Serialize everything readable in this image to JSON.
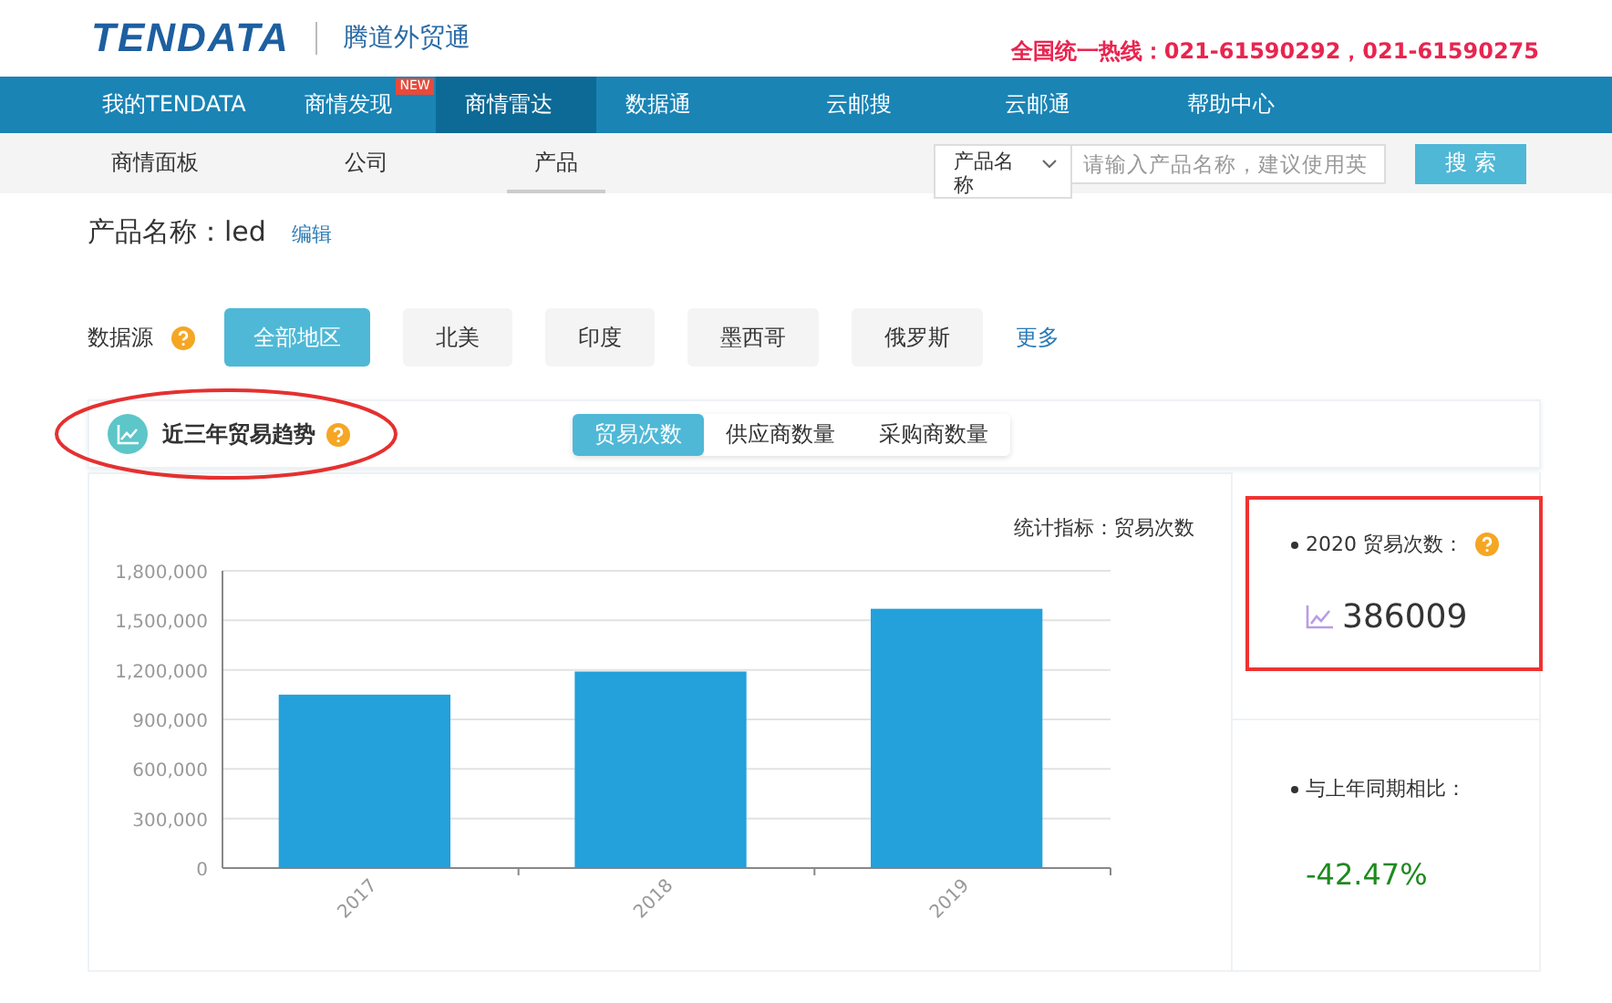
{
  "header": {
    "logo": "TENDATA",
    "brand": "腾道外贸通",
    "hotline": "全国统一热线：021-61590292，021-61590275"
  },
  "nav": [
    {
      "label": "我的TENDATA",
      "selected": false
    },
    {
      "label": "商情发现",
      "selected": false,
      "badge": "NEW"
    },
    {
      "label": "商情雷达",
      "selected": true
    },
    {
      "label": "数据通",
      "selected": false
    },
    {
      "label": "云邮搜",
      "selected": false
    },
    {
      "label": "云邮通",
      "selected": false
    },
    {
      "label": "帮助中心",
      "selected": false
    }
  ],
  "subnav": [
    {
      "label": "商情面板",
      "selected": false
    },
    {
      "label": "公司",
      "selected": false
    },
    {
      "label": "产品",
      "selected": true
    }
  ],
  "search": {
    "select": "产品名称",
    "placeholder": "请输入产品名称，建议使用英",
    "button": "搜 索"
  },
  "product": {
    "label": "产品名称：led",
    "edit": "编辑"
  },
  "source": {
    "label": "数据源",
    "options": [
      {
        "label": "全部地区",
        "selected": true
      },
      {
        "label": "北美",
        "selected": false
      },
      {
        "label": "印度",
        "selected": false
      },
      {
        "label": "墨西哥",
        "selected": false
      },
      {
        "label": "俄罗斯",
        "selected": false
      }
    ],
    "more": "更多"
  },
  "trend": {
    "title": "近三年贸易趋势",
    "tabs": [
      {
        "label": "贸易次数",
        "selected": true
      },
      {
        "label": "供应商数量",
        "selected": false
      },
      {
        "label": "采购商数量",
        "selected": false
      }
    ],
    "metric": "统计指标：贸易次数",
    "chart_data": {
      "type": "bar",
      "categories": [
        "2017",
        "2018",
        "2019"
      ],
      "series": [
        {
          "color": "#24a0da",
          "values": [
            1050000,
            1190000,
            1570000
          ]
        }
      ],
      "grid": true,
      "ylim": [
        0,
        1800000
      ],
      "yticks": [
        {
          "value": 0,
          "label": "0"
        },
        {
          "value": 300000,
          "label": "300,000"
        },
        {
          "value": 600000,
          "label": "600,000"
        },
        {
          "value": 900000,
          "label": "900,000"
        },
        {
          "value": 1200000,
          "label": "1,200,000"
        },
        {
          "value": 1500000,
          "label": "1,500,000"
        },
        {
          "value": 1800000,
          "label": "1,800,000"
        }
      ]
    }
  },
  "stats": [
    {
      "label": "2020 贸易次数：",
      "value": "386009",
      "kind": "count"
    },
    {
      "label": "与上年同期相比：",
      "value": "-42.47%",
      "kind": "change"
    }
  ],
  "annotations": [
    {
      "kind": "ellipse"
    },
    {
      "kind": "rectangle"
    }
  ]
}
